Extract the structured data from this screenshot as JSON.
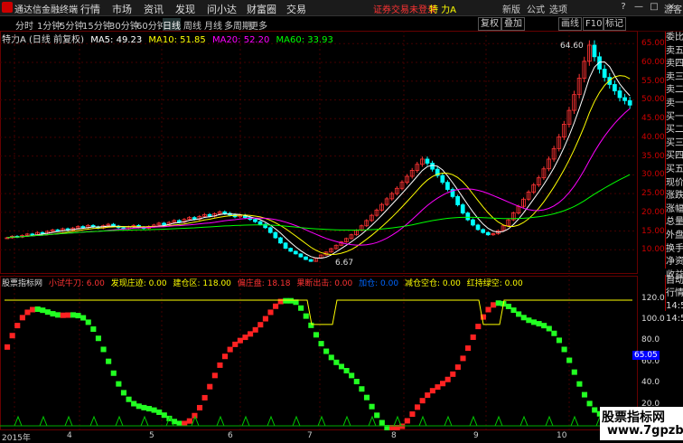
{
  "app": {
    "name": "通达信金融终端"
  },
  "menu": [
    "行情",
    "市场",
    "资讯",
    "发现",
    "问小达",
    "财富圈",
    "交易"
  ],
  "alert_text": "证券交易未登录",
  "stock_title": "特 力A",
  "window_buttons": [
    "?",
    "—",
    "□",
    "×"
  ],
  "periods": [
    "分时",
    "1分钟",
    "5分钟",
    "15分钟",
    "30分钟",
    "60分钟",
    "日线",
    "周线",
    "月线",
    "多周期",
    "更多"
  ],
  "active_period": "日线",
  "right_tools": [
    "复权",
    "叠加",
    "画线",
    "F10",
    "标记"
  ],
  "right_tools_b": [
    "新版",
    "公式",
    "选项"
  ],
  "guest": "游客",
  "main_legend": {
    "name": "特力A (日线 前复权)",
    "ma5": "MA5: 49.23",
    "ma10": "MA10: 51.85",
    "ma20": "MA20: 52.20",
    "ma60": "MA60: 33.93",
    "colors": {
      "ma5": "#ffffff",
      "ma10": "#ffff00",
      "ma20": "#ff00ff",
      "ma60": "#00ff00"
    }
  },
  "indicator_legend": {
    "name": "股票指标网",
    "items": [
      {
        "text": "小试牛刀: 6.00",
        "color": "#ff3333"
      },
      {
        "text": "发现庄迹: 0.00",
        "color": "#ffff00"
      },
      {
        "text": "建仓区: 118.00",
        "color": "#ffff00"
      },
      {
        "text": "偏庄盘: 18.18",
        "color": "#ff3333"
      },
      {
        "text": "果断出击: 0.00",
        "color": "#ff3333"
      },
      {
        "text": "加仓: 0.00",
        "color": "#0066ff"
      },
      {
        "text": "减仓空仓: 0.00",
        "color": "#ffff00"
      },
      {
        "text": "红持绿空: 0.00",
        "color": "#ffff00"
      }
    ]
  },
  "price_axis": [
    "65.00",
    "60.00",
    "55.00",
    "50.00",
    "45.00",
    "40.00",
    "35.00",
    "30.00",
    "25.00",
    "20.00",
    "15.00",
    "10.00"
  ],
  "indicator_axis": [
    "120.0",
    "100.0",
    "80.0",
    "60.0",
    "40.0",
    "20.0"
  ],
  "indicator_marker": "65.05",
  "side_panel": [
    "委比",
    "卖五",
    "卖四",
    "卖三",
    "卖二",
    "卖一",
    "买一",
    "买二",
    "买三",
    "买四",
    "买五",
    "现价",
    "涨跌",
    "涨幅",
    "总量",
    "外盘",
    "换手",
    "净资",
    "收益"
  ],
  "side_panel2": [
    "自动",
    "行情",
    "14:50",
    "14:50"
  ],
  "dates": [
    "2015年",
    "4",
    "5",
    "6",
    "7",
    "8",
    "9",
    "10"
  ],
  "annotations": {
    "high": "64.60",
    "low": "6.67"
  },
  "watermark": {
    "line1": "股票指标网",
    "line2": "www.7gpzb.com"
  },
  "chart_data": {
    "type": "candlestick",
    "price_range": [
      5,
      67
    ],
    "high_label": 64.6,
    "low_label": 6.67,
    "close": [
      13.2,
      13.6,
      13.4,
      13.8,
      14.2,
      14.0,
      14.6,
      14.4,
      14.9,
      15.3,
      15.1,
      15.6,
      15.2,
      15.8,
      16.2,
      15.9,
      16.5,
      16.1,
      15.8,
      16.4,
      16.8,
      16.3,
      15.9,
      15.6,
      16.1,
      16.5,
      16.0,
      15.7,
      16.2,
      16.6,
      17.1,
      16.7,
      17.3,
      17.8,
      17.4,
      18.1,
      18.6,
      18.2,
      18.9,
      19.4,
      19.0,
      19.6,
      20.1,
      19.7,
      19.3,
      18.8,
      19.2,
      18.6,
      18.1,
      17.5,
      16.8,
      15.9,
      14.6,
      13.2,
      11.8,
      10.4,
      9.6,
      8.9,
      8.1,
      7.4,
      6.9,
      7.8,
      8.6,
      9.4,
      10.3,
      11.2,
      12.1,
      13.0,
      14.0,
      15.2,
      16.4,
      17.8,
      19.2,
      20.6,
      22.1,
      23.6,
      25.0,
      26.4,
      28.0,
      29.6,
      31.2,
      32.8,
      34.2,
      33.1,
      31.5,
      29.8,
      28.0,
      26.1,
      24.2,
      22.0,
      19.8,
      18.0,
      16.6,
      15.4,
      14.6,
      14.0,
      14.3,
      15.1,
      16.4,
      18.0,
      19.8,
      21.6,
      23.5,
      25.4,
      27.3,
      29.2,
      31.6,
      34.2,
      37.0,
      40.1,
      43.5,
      47.2,
      51.4,
      55.8,
      60.3,
      64.6,
      61.5,
      58.2,
      56.0,
      54.1,
      52.4,
      50.6,
      49.8,
      48.6
    ]
  }
}
